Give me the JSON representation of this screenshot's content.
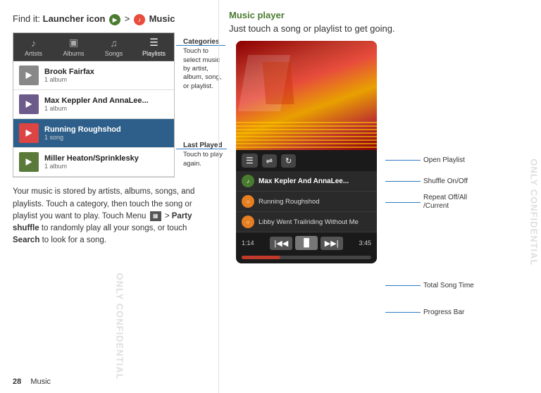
{
  "left": {
    "find_it_label": "Find it:",
    "launcher_label": "Launcher icon",
    "arrow": ">",
    "music_label": "Music",
    "categories": {
      "label": "Categories",
      "description": "Touch to select music by artist, album, song, or playlist.",
      "tabs": [
        {
          "id": "artists",
          "label": "Artists",
          "icon": "♪",
          "active": false
        },
        {
          "id": "albums",
          "label": "Albums",
          "icon": "▣",
          "active": false
        },
        {
          "id": "songs",
          "label": "Songs",
          "icon": "♫",
          "active": false
        },
        {
          "id": "playlists",
          "label": "Playlists",
          "icon": "☰",
          "active": true
        }
      ]
    },
    "last_played": {
      "label": "Last Played",
      "description": "Touch to play again."
    },
    "songs": [
      {
        "name": "Brook Fairfax",
        "sub": "1 album",
        "highlighted": false
      },
      {
        "name": "Max Keppler And AnnaLee...",
        "sub": "1 album",
        "highlighted": false
      },
      {
        "name": "Running Roughshod",
        "sub": "1 song",
        "highlighted": true
      },
      {
        "name": "Miller Heaton/Sprinklesky",
        "sub": "1 album",
        "highlighted": false
      }
    ],
    "body_text": "Your music is stored by artists, albums, songs, and playlists. Touch a category, then touch the song or playlist you want to play. Touch Menu",
    "body_text2": "> Party shuffle to randomly play all your songs, or touch Search to look for a song.",
    "party_shuffle": "Party shuffle",
    "search": "Search",
    "page_number": "28",
    "page_label": "Music"
  },
  "right": {
    "section_title": "Music player",
    "subtitle": "Just touch a song or playlist to get going.",
    "player": {
      "now_playing": [
        {
          "name": "Max Kepler And AnnaLee...",
          "bold": true,
          "icon_type": "green"
        },
        {
          "name": "Running Roughshod",
          "bold": false,
          "icon_type": "orange"
        },
        {
          "name": "Libby Went Trailriding Without  Me",
          "bold": false,
          "icon_type": "orange"
        }
      ],
      "time_current": "1:14",
      "time_total": "3:45",
      "annotations": [
        {
          "label": "Open Playlist"
        },
        {
          "label": "Shuffle On/Off"
        },
        {
          "label": "Repeat Off/All\n/Current"
        },
        {
          "label": "Total Song Time"
        },
        {
          "label": "Progress Bar"
        }
      ]
    }
  },
  "watermark": "ONLY CONFIDENTIAL"
}
